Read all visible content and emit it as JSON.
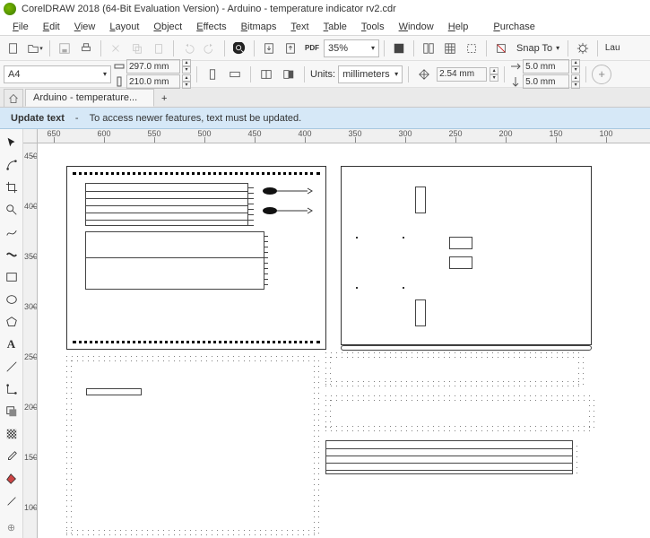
{
  "title": "CorelDRAW 2018 (64-Bit Evaluation Version) - Arduino - temperature indicator rv2.cdr",
  "menu": [
    "File",
    "Edit",
    "View",
    "Layout",
    "Object",
    "Effects",
    "Bitmaps",
    "Text",
    "Table",
    "Tools",
    "Window",
    "Help",
    "Purchase"
  ],
  "toolbar1": {
    "zoom_value": "35%",
    "snap_label": "Snap To",
    "launch_label": "Lau"
  },
  "toolbar2": {
    "page_size": "A4",
    "width": "297.0 mm",
    "height": "210.0 mm",
    "units_label": "Units:",
    "units_value": "millimeters",
    "nudge": "2.54 mm",
    "dup_x": "5.0 mm",
    "dup_y": "5.0 mm"
  },
  "doctab": "Arduino - temperature...",
  "info": {
    "action": "Update text",
    "dash": "-",
    "message": "To access newer features, text must be updated."
  },
  "ruler_h": [
    "650",
    "600",
    "550",
    "500",
    "450",
    "400",
    "350",
    "300",
    "250",
    "200",
    "150",
    "100"
  ],
  "ruler_v": [
    "450",
    "400",
    "350",
    "300",
    "250",
    "200",
    "150",
    "100"
  ]
}
